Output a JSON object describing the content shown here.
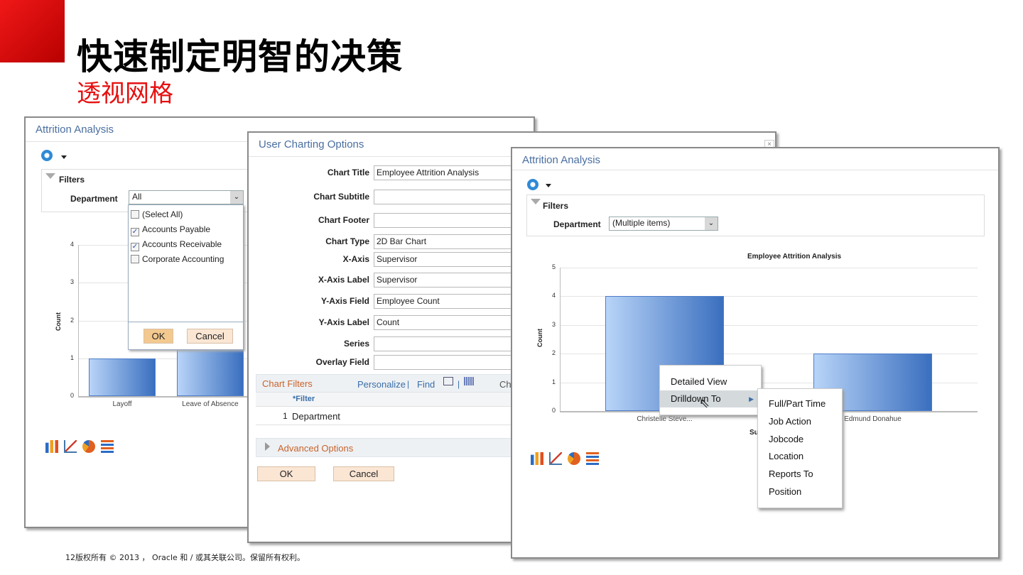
{
  "slide": {
    "title": "快速制定明智的决策",
    "subtitle": "透视网格",
    "footer": "12版权所有 © 2013 ， Oracle 和 / 或其关联公司。保留所有权利。"
  },
  "panel1": {
    "title": "Attrition Analysis",
    "filters_label": "Filters",
    "department_label": "Department",
    "department_value": "All",
    "dropdown_items": [
      {
        "label": "(Select All)",
        "checked": false
      },
      {
        "label": "Accounts Payable",
        "checked": true
      },
      {
        "label": "Accounts Receivable",
        "checked": true
      },
      {
        "label": "Corporate Accounting",
        "checked": false
      }
    ],
    "ok_label": "OK",
    "cancel_label": "Cancel",
    "y_label": "Count"
  },
  "panel2": {
    "title": "User Charting Options",
    "close": "×",
    "fields": [
      {
        "label": "Chart Title",
        "value": "Employee Attrition Analysis"
      },
      {
        "label": "Chart Subtitle",
        "value": ""
      },
      {
        "label": "Chart Footer",
        "value": ""
      },
      {
        "label": "Chart Type",
        "value": "2D Bar Chart"
      },
      {
        "label": "X-Axis",
        "value": "Supervisor"
      },
      {
        "label": "X-Axis Label",
        "value": "Supervisor"
      },
      {
        "label": "Y-Axis Field",
        "value": "Employee Count"
      },
      {
        "label": "Y-Axis Label",
        "value": "Count"
      },
      {
        "label": "Series",
        "value": ""
      },
      {
        "label": "Overlay Field",
        "value": ""
      }
    ],
    "chart_filters": {
      "title": "Chart Filters",
      "personalize": "Personalize",
      "find": "Find",
      "sep": "|",
      "extra": "Ch",
      "col_header": "*Filter",
      "rows": [
        {
          "num": "1",
          "filter": "Department"
        }
      ]
    },
    "advanced_options": "Advanced Options",
    "ok_label": "OK",
    "cancel_label": "Cancel"
  },
  "panel3": {
    "title": "Attrition Analysis",
    "filters_label": "Filters",
    "department_label": "Department",
    "department_value": "(Multiple items)",
    "x_label_partial": "Su",
    "context_menu": {
      "items": [
        "Detailed View",
        "Drilldown To"
      ]
    },
    "submenu": {
      "items": [
        "Full/Part Time",
        "Job Action",
        "Jobcode",
        "Location",
        "Reports To",
        "Position"
      ]
    }
  },
  "chart_data": [
    {
      "type": "bar",
      "title": "",
      "xlabel": "",
      "ylabel": "Count",
      "categories": [
        "Layoff",
        "Leave of Absence"
      ],
      "values": [
        1,
        2
      ],
      "ylim": [
        0,
        4
      ],
      "yticks": [
        "0",
        "1",
        "2",
        "3",
        "4"
      ]
    },
    {
      "type": "bar",
      "title": "Employee Attrition Analysis",
      "xlabel": "Supervisor",
      "ylabel": "Count",
      "categories": [
        "Christelle Steve...",
        "Edmund Donahue"
      ],
      "values": [
        4,
        2
      ],
      "ylim": [
        0,
        5
      ],
      "yticks": [
        "0",
        "1",
        "2",
        "3",
        "4",
        "5"
      ]
    }
  ]
}
